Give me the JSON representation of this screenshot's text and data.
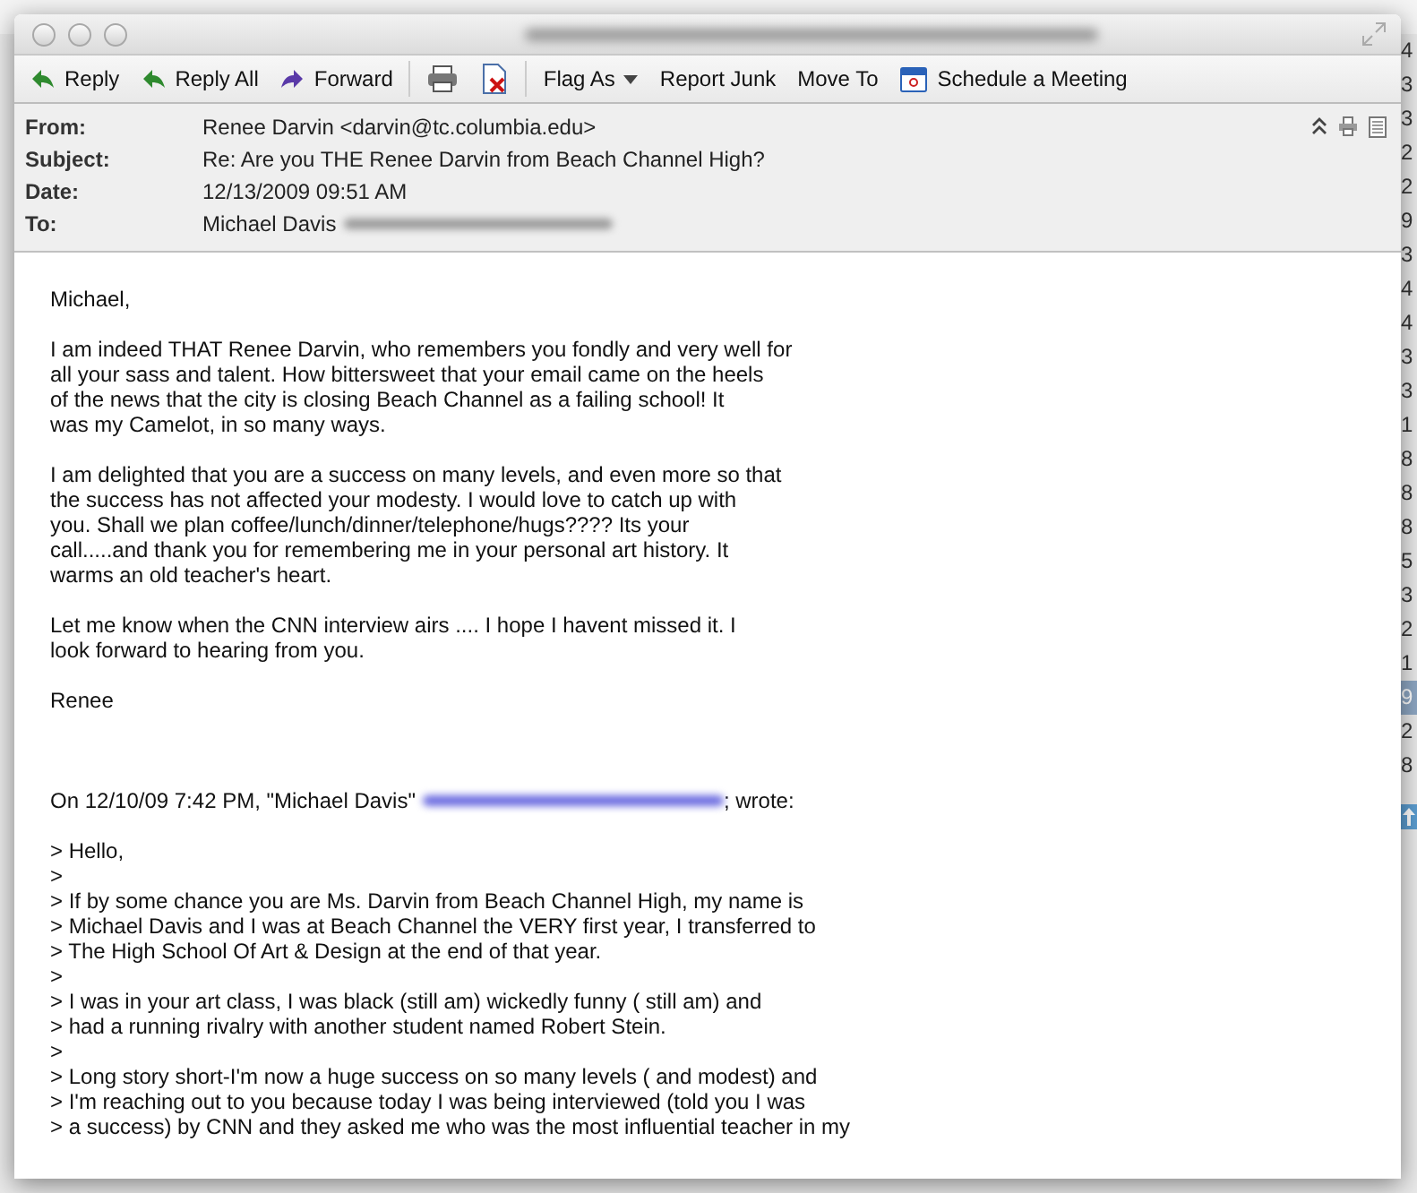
{
  "background_list": {
    "time_fragments": [
      {
        "text": "4",
        "selected": false
      },
      {
        "text": "3",
        "selected": false
      },
      {
        "text": "3",
        "selected": false
      },
      {
        "text": "2",
        "selected": false
      },
      {
        "text": "2",
        "selected": false
      },
      {
        "text": "9",
        "selected": false
      },
      {
        "text": "3",
        "selected": false
      },
      {
        "text": "4",
        "selected": false
      },
      {
        "text": "4",
        "selected": false
      },
      {
        "text": "3",
        "selected": false
      },
      {
        "text": "3",
        "selected": false
      },
      {
        "text": "1",
        "selected": false
      },
      {
        "text": "8",
        "selected": false
      },
      {
        "text": "8",
        "selected": false
      },
      {
        "text": "8",
        "selected": false
      },
      {
        "text": "5",
        "selected": false
      },
      {
        "text": "3",
        "selected": false
      },
      {
        "text": "2",
        "selected": false
      },
      {
        "text": "1",
        "selected": false
      },
      {
        "text": "9",
        "selected": true
      },
      {
        "text": "2",
        "selected": false
      },
      {
        "text": "8",
        "selected": false
      }
    ]
  },
  "window": {
    "title_redacted": true,
    "actions": [
      {
        "label": "Reply"
      },
      {
        "label": "Reply All"
      },
      {
        "label": "Forward"
      }
    ],
    "commands": [
      {
        "label": "Flag As",
        "kind": "menu"
      },
      {
        "label": "Report Junk",
        "kind": "plain"
      },
      {
        "label": "Move To",
        "kind": "plain"
      },
      {
        "label": "Schedule a Meeting",
        "kind": "calendar"
      }
    ],
    "headers": [
      {
        "label": "From:",
        "value": "Renee Darvin <darvin@tc.columbia.edu>",
        "redacted": false
      },
      {
        "label": "Subject:",
        "value": "Re: Are you THE Renee Darvin from Beach Channel High?",
        "redacted": false
      },
      {
        "label": "Date:",
        "value": "12/13/2009 09:51 AM",
        "redacted": false
      },
      {
        "label": "To:",
        "value": "Michael Davis",
        "redacted": true
      }
    ],
    "body": {
      "greeting": "Michael,",
      "paragraphs": [
        [
          "I am indeed THAT Renee Darvin, who remembers you fondly and very well for",
          "all your sass and talent. How bittersweet that your email came on the heels",
          "of the news that the city is closing Beach Channel as a failing school! It",
          "was my Camelot, in so many ways."
        ],
        [
          "I am delighted that you are a success on many levels, and even more so that",
          "the success has not affected your modesty. I would love to catch up with",
          "you. Shall we plan coffee/lunch/dinner/telephone/hugs???? Its your",
          "call.....and thank you for remembering me in your personal art history. It",
          "warms an old teacher's heart."
        ],
        [
          "Let me know when the CNN interview airs .... I hope I havent missed it. I",
          "look forward to hearing from you."
        ]
      ],
      "signature": "Renee",
      "quote_intro": {
        "before": "On 12/10/09 7:42 PM, \"Michael Davis\"",
        "after": "; wrote:",
        "redacted": true
      },
      "quoted_lines": [
        "> Hello,",
        ">",
        "> If by some chance you are Ms. Darvin from Beach Channel High, my name is",
        "> Michael Davis and I was at Beach Channel the VERY first year, I transferred to",
        "> The High School Of Art & Design at the end of that year.",
        ">",
        "> I was in your art class, I was black (still am) wickedly funny ( still am) and",
        "> had a running rivalry with another student named Robert Stein.",
        ">",
        "> Long story short-I'm now a huge success on so many levels ( and modest) and",
        "> I'm reaching out to you because today I was being interviewed (told you I was",
        "> a success) by CNN and they asked me who was the most influential teacher in my"
      ]
    }
  }
}
